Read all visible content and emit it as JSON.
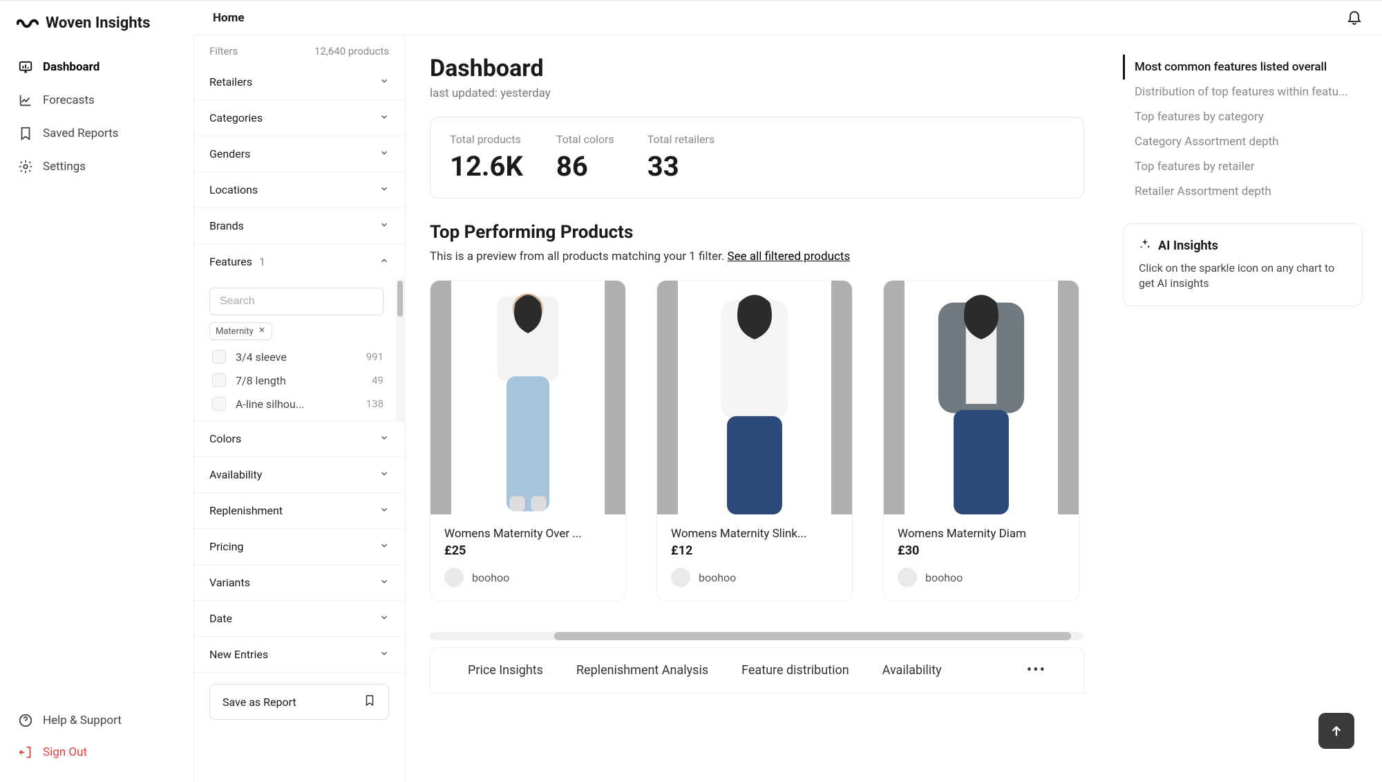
{
  "brand": "Woven Insights",
  "breadcrumb": "Home",
  "nav": {
    "dashboard": "Dashboard",
    "forecasts": "Forecasts",
    "saved_reports": "Saved Reports",
    "settings": "Settings",
    "help": "Help & Support",
    "signout": "Sign Out"
  },
  "filters_header": {
    "label": "Filters",
    "count": "12,640 products"
  },
  "filters": {
    "retailers": "Retailers",
    "categories": "Categories",
    "genders": "Genders",
    "locations": "Locations",
    "brands": "Brands",
    "features": "Features",
    "features_count": "1",
    "colors": "Colors",
    "availability": "Availability",
    "replenishment": "Replenishment",
    "pricing": "Pricing",
    "variants": "Variants",
    "date": "Date",
    "new_entries": "New Entries"
  },
  "features_search_placeholder": "Search",
  "features_chip": "Maternity",
  "features_list": [
    {
      "label": "3/4 sleeve",
      "count": "991"
    },
    {
      "label": "7/8 length",
      "count": "49"
    },
    {
      "label": "A-line silhou...",
      "count": "138"
    }
  ],
  "save_report": "Save as Report",
  "page": {
    "title": "Dashboard",
    "subtitle": "last updated: yesterday"
  },
  "stats": [
    {
      "label": "Total products",
      "value": "12.6K"
    },
    {
      "label": "Total colors",
      "value": "86"
    },
    {
      "label": "Total retailers",
      "value": "33"
    }
  ],
  "top_products": {
    "title": "Top Performing Products",
    "subtitle_prefix": "This is a preview from all products matching your 1 filter. ",
    "link": "See all filtered products"
  },
  "products": [
    {
      "title": "Womens Maternity Over ...",
      "price": "£25",
      "brand": "boohoo"
    },
    {
      "title": "Womens Maternity Slink...",
      "price": "£12",
      "brand": "boohoo"
    },
    {
      "title": "Womens Maternity Diam",
      "price": "£30",
      "brand": "boohoo"
    }
  ],
  "tabs": {
    "price": "Price Insights",
    "replenishment": "Replenishment Analysis",
    "feature": "Feature distribution",
    "availability": "Availability"
  },
  "toc": {
    "t0": "Most common features listed overall",
    "t1": "Distribution of top features within featu...",
    "t2": "Top features by category",
    "t3": "Category Assortment depth",
    "t4": "Top features by retailer",
    "t5": "Retailer Assortment depth"
  },
  "ai": {
    "title": "AI Insights",
    "desc": "Click on the sparkle icon on any chart to get AI insights"
  }
}
